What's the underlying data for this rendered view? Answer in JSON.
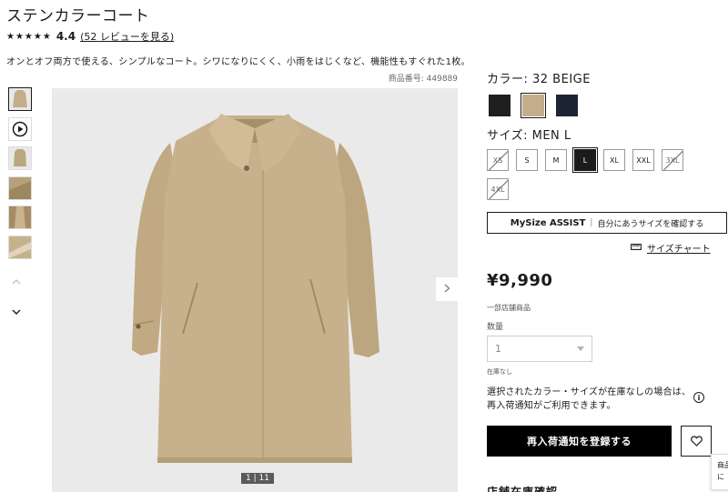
{
  "product": {
    "title": "ステンカラーコート",
    "stars": "★★★★★",
    "rating": "4.4",
    "review_link": "(52 レビューを見る)",
    "description": "オンとオフ両方で使える、シンプルなコート。シワになりにくく、小雨をはじくなど、機能性もすぐれた1枚。",
    "product_number": "商品番号: 449889"
  },
  "gallery": {
    "counter": "1 | 11",
    "next_icon": "chevron-right-icon",
    "thumbnails": [
      "coat-front",
      "video-play",
      "coat-back",
      "coat-detail-1",
      "coat-detail-2",
      "coat-detail-3"
    ]
  },
  "color": {
    "label": "カラー:  32 BEIGE",
    "swatches": [
      {
        "name": "black",
        "color": "#1f1f1f",
        "selected": false
      },
      {
        "name": "beige",
        "color": "#c3ad8a",
        "selected": true
      },
      {
        "name": "navy",
        "color": "#1d2433",
        "selected": false
      }
    ]
  },
  "size": {
    "label": "サイズ:  MEN L",
    "options": [
      {
        "label": "XS",
        "state": "na"
      },
      {
        "label": "S",
        "state": "ok"
      },
      {
        "label": "M",
        "state": "ok"
      },
      {
        "label": "L",
        "state": "sel"
      },
      {
        "label": "XL",
        "state": "ok"
      },
      {
        "label": "XXL",
        "state": "ok"
      },
      {
        "label": "3XL",
        "state": "na"
      },
      {
        "label": "4XL",
        "state": "na"
      }
    ]
  },
  "mysize": {
    "brand": "MySize ASSIST",
    "separator": "|",
    "text": "自分にあうサイズを確認する"
  },
  "size_chart": {
    "label": "サイズチャート",
    "icon": "ruler-icon"
  },
  "price": "¥9,990",
  "store_only": "一部店舗商品",
  "quantity": {
    "label": "数量",
    "value": "1"
  },
  "stock_status": "在庫なし",
  "notice": "選択されたカラー・サイズが在庫なしの場合は、再入荷通知がご利用できます。",
  "info_icon": "i",
  "restock_button": "再入荷通知を登録する",
  "favorite_icon": "heart-icon",
  "tooltip": {
    "line1": "商品",
    "line2": "に"
  },
  "bottom_text": "店舗在庫確認"
}
